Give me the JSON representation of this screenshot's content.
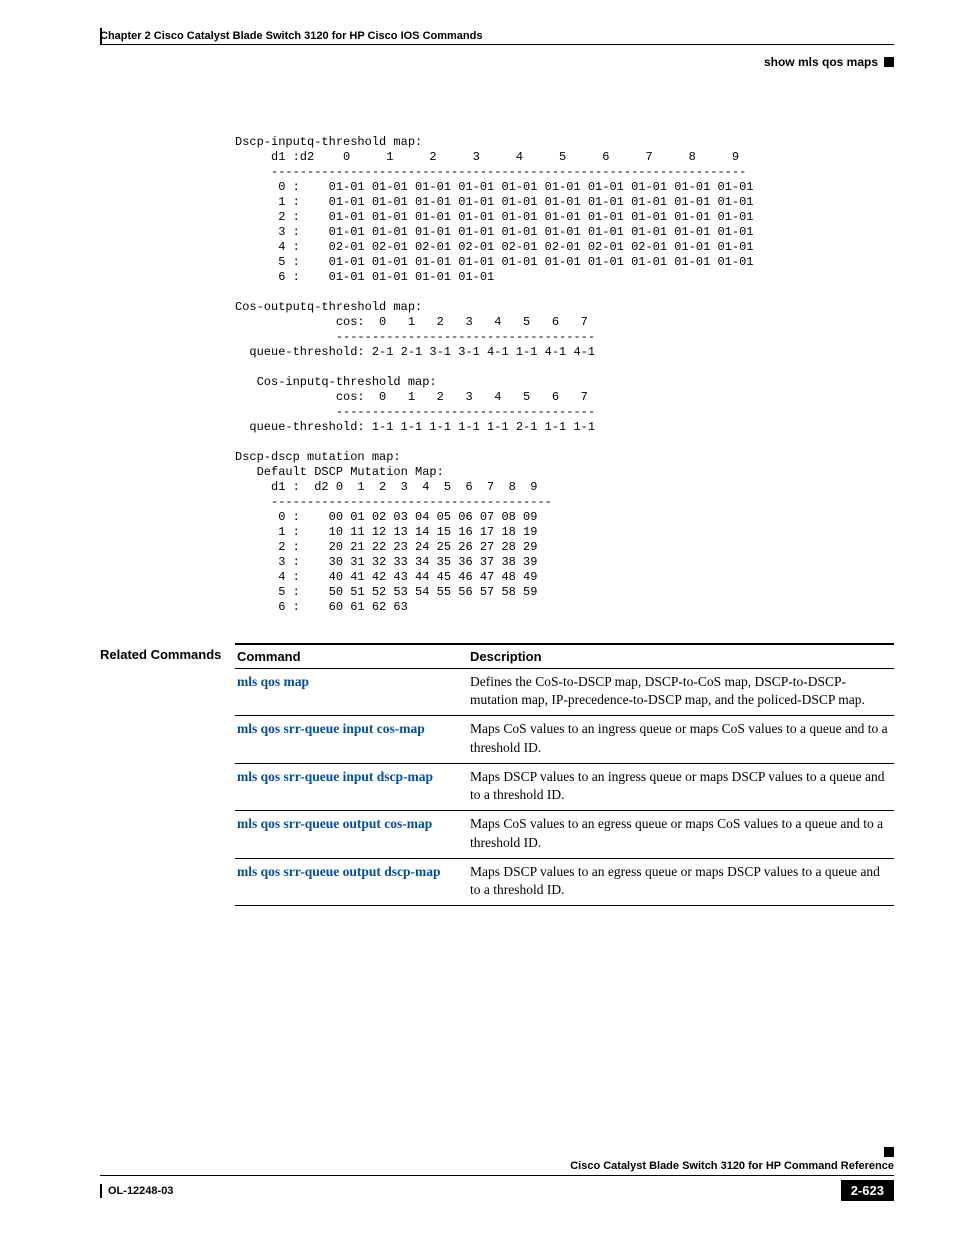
{
  "header": {
    "chapter": "Chapter 2  Cisco Catalyst Blade Switch 3120 for HP Cisco IOS Commands",
    "breadcrumb": "show mls qos maps"
  },
  "code": "Dscp-inputq-threshold map:\n     d1 :d2    0     1     2     3     4     5     6     7     8     9 \n     ------------------------------------------------------------------\n      0 :    01-01 01-01 01-01 01-01 01-01 01-01 01-01 01-01 01-01 01-01 \n      1 :    01-01 01-01 01-01 01-01 01-01 01-01 01-01 01-01 01-01 01-01 \n      2 :    01-01 01-01 01-01 01-01 01-01 01-01 01-01 01-01 01-01 01-01 \n      3 :    01-01 01-01 01-01 01-01 01-01 01-01 01-01 01-01 01-01 01-01 \n      4 :    02-01 02-01 02-01 02-01 02-01 02-01 02-01 02-01 01-01 01-01 \n      5 :    01-01 01-01 01-01 01-01 01-01 01-01 01-01 01-01 01-01 01-01 \n      6 :    01-01 01-01 01-01 01-01 \n\nCos-outputq-threshold map:\n              cos:  0   1   2   3   4   5   6   7 \n              ------------------------------------\n  queue-threshold: 2-1 2-1 3-1 3-1 4-1 1-1 4-1 4-1 \n\n   Cos-inputq-threshold map:\n              cos:  0   1   2   3   4   5   6   7 \n              ------------------------------------\n  queue-threshold: 1-1 1-1 1-1 1-1 1-1 2-1 1-1 1-1 \n\nDscp-dscp mutation map:\n   Default DSCP Mutation Map:\n     d1 :  d2 0  1  2  3  4  5  6  7  8  9 \n     ---------------------------------------\n      0 :    00 01 02 03 04 05 06 07 08 09 \n      1 :    10 11 12 13 14 15 16 17 18 19 \n      2 :    20 21 22 23 24 25 26 27 28 29 \n      3 :    30 31 32 33 34 35 36 37 38 39 \n      4 :    40 41 42 43 44 45 46 47 48 49 \n      5 :    50 51 52 53 54 55 56 57 58 59 \n      6 :    60 61 62 63 ",
  "related": {
    "label": "Related Commands",
    "headers": {
      "cmd": "Command",
      "desc": "Description"
    },
    "rows": [
      {
        "cmd": "mls qos map",
        "desc": "Defines the CoS-to-DSCP map, DSCP-to-CoS map, DSCP-to-DSCP-mutation map, IP-precedence-to-DSCP map, and the policed-DSCP map."
      },
      {
        "cmd": "mls qos srr-queue input cos-map",
        "desc": "Maps CoS values to an ingress queue or maps CoS values to a queue and to a threshold ID."
      },
      {
        "cmd": "mls qos srr-queue input dscp-map",
        "desc": "Maps DSCP values to an ingress queue or maps DSCP values to a queue and to a threshold ID."
      },
      {
        "cmd": "mls qos srr-queue output cos-map",
        "desc": "Maps CoS values to an egress queue or maps CoS values to a queue and to a threshold ID."
      },
      {
        "cmd": "mls qos srr-queue output dscp-map",
        "desc": "Maps DSCP values to an egress queue or maps DSCP values to a queue and to a threshold ID."
      }
    ]
  },
  "footer": {
    "book": "Cisco Catalyst Blade Switch 3120 for HP Command Reference",
    "ol": "OL-12248-03",
    "page": "2-623"
  }
}
